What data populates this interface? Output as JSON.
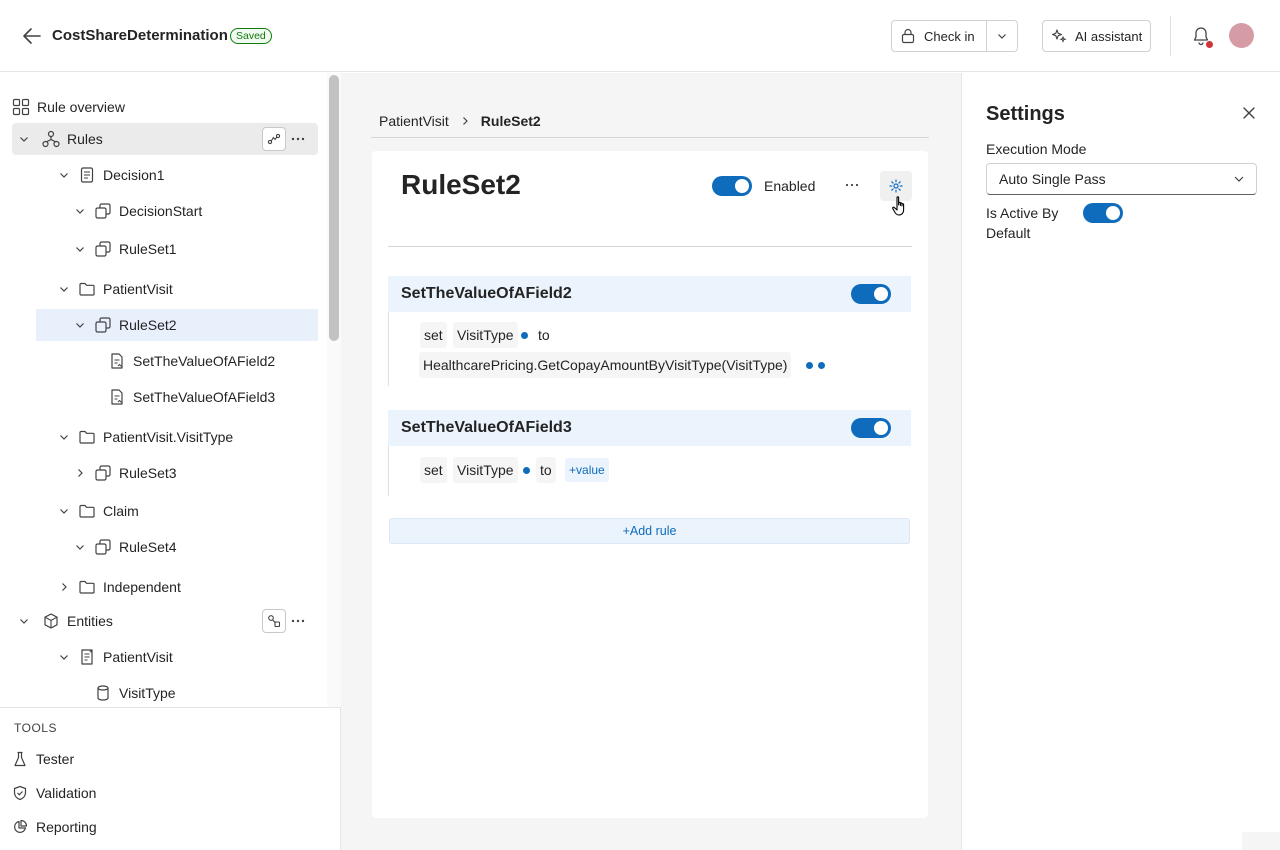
{
  "header": {
    "title": "CostShareDetermination",
    "status_badge": "Saved",
    "check_in_label": "Check in",
    "ai_assistant_label": "AI assistant"
  },
  "sidebar": {
    "tree": [
      {
        "label": "Rule overview",
        "icon": "grid-icon"
      },
      {
        "label": "Rules",
        "icon": "hierarchy-icon"
      },
      {
        "label": "Decision1",
        "icon": "document-icon"
      },
      {
        "label": "DecisionStart",
        "icon": "ruleset-icon"
      },
      {
        "label": "RuleSet1",
        "icon": "ruleset-icon"
      },
      {
        "label": "PatientVisit",
        "icon": "folder-icon"
      },
      {
        "label": "RuleSet2",
        "icon": "ruleset-icon"
      },
      {
        "label": "SetTheValueOfAField2",
        "icon": "rule-icon"
      },
      {
        "label": "SetTheValueOfAField3",
        "icon": "rule-icon"
      },
      {
        "label": "PatientVisit.VisitType",
        "icon": "folder-icon"
      },
      {
        "label": "RuleSet3",
        "icon": "ruleset-icon"
      },
      {
        "label": "Claim",
        "icon": "folder-icon"
      },
      {
        "label": "RuleSet4",
        "icon": "ruleset-icon"
      },
      {
        "label": "Independent",
        "icon": "folder-icon"
      },
      {
        "label": "Entities",
        "icon": "cube-icon"
      },
      {
        "label": "PatientVisit",
        "icon": "entity-icon"
      },
      {
        "label": "VisitType",
        "icon": "cylinder-icon"
      }
    ],
    "tools_title": "TOOLS",
    "tools": [
      {
        "label": "Tester",
        "icon": "flask-icon"
      },
      {
        "label": "Validation",
        "icon": "shield-check-icon"
      },
      {
        "label": "Reporting",
        "icon": "pie-chart-icon"
      }
    ]
  },
  "main": {
    "breadcrumb": [
      "PatientVisit",
      "RuleSet2"
    ],
    "ruleset_title": "RuleSet2",
    "enabled_label": "Enabled",
    "rules": [
      {
        "name": "SetTheValueOfAField2",
        "set_word": "set",
        "field": "VisitType",
        "to_word": "to",
        "expression": "HealthcarePricing.GetCopayAmountByVisitType(VisitType)"
      },
      {
        "name": "SetTheValueOfAField3",
        "set_word": "set",
        "field": "VisitType",
        "to_word": "to",
        "value_link": "value"
      }
    ],
    "add_rule_label": "Add rule"
  },
  "settings": {
    "title": "Settings",
    "execution_mode_label": "Execution Mode",
    "execution_mode_value": "Auto Single Pass",
    "active_by_default_label": "Is Active By Default"
  },
  "colors": {
    "accent": "#0f6cbd",
    "selected_row": "#e8f0fb",
    "rule_header": "#ebf3fc",
    "saved_green": "#107c10"
  }
}
